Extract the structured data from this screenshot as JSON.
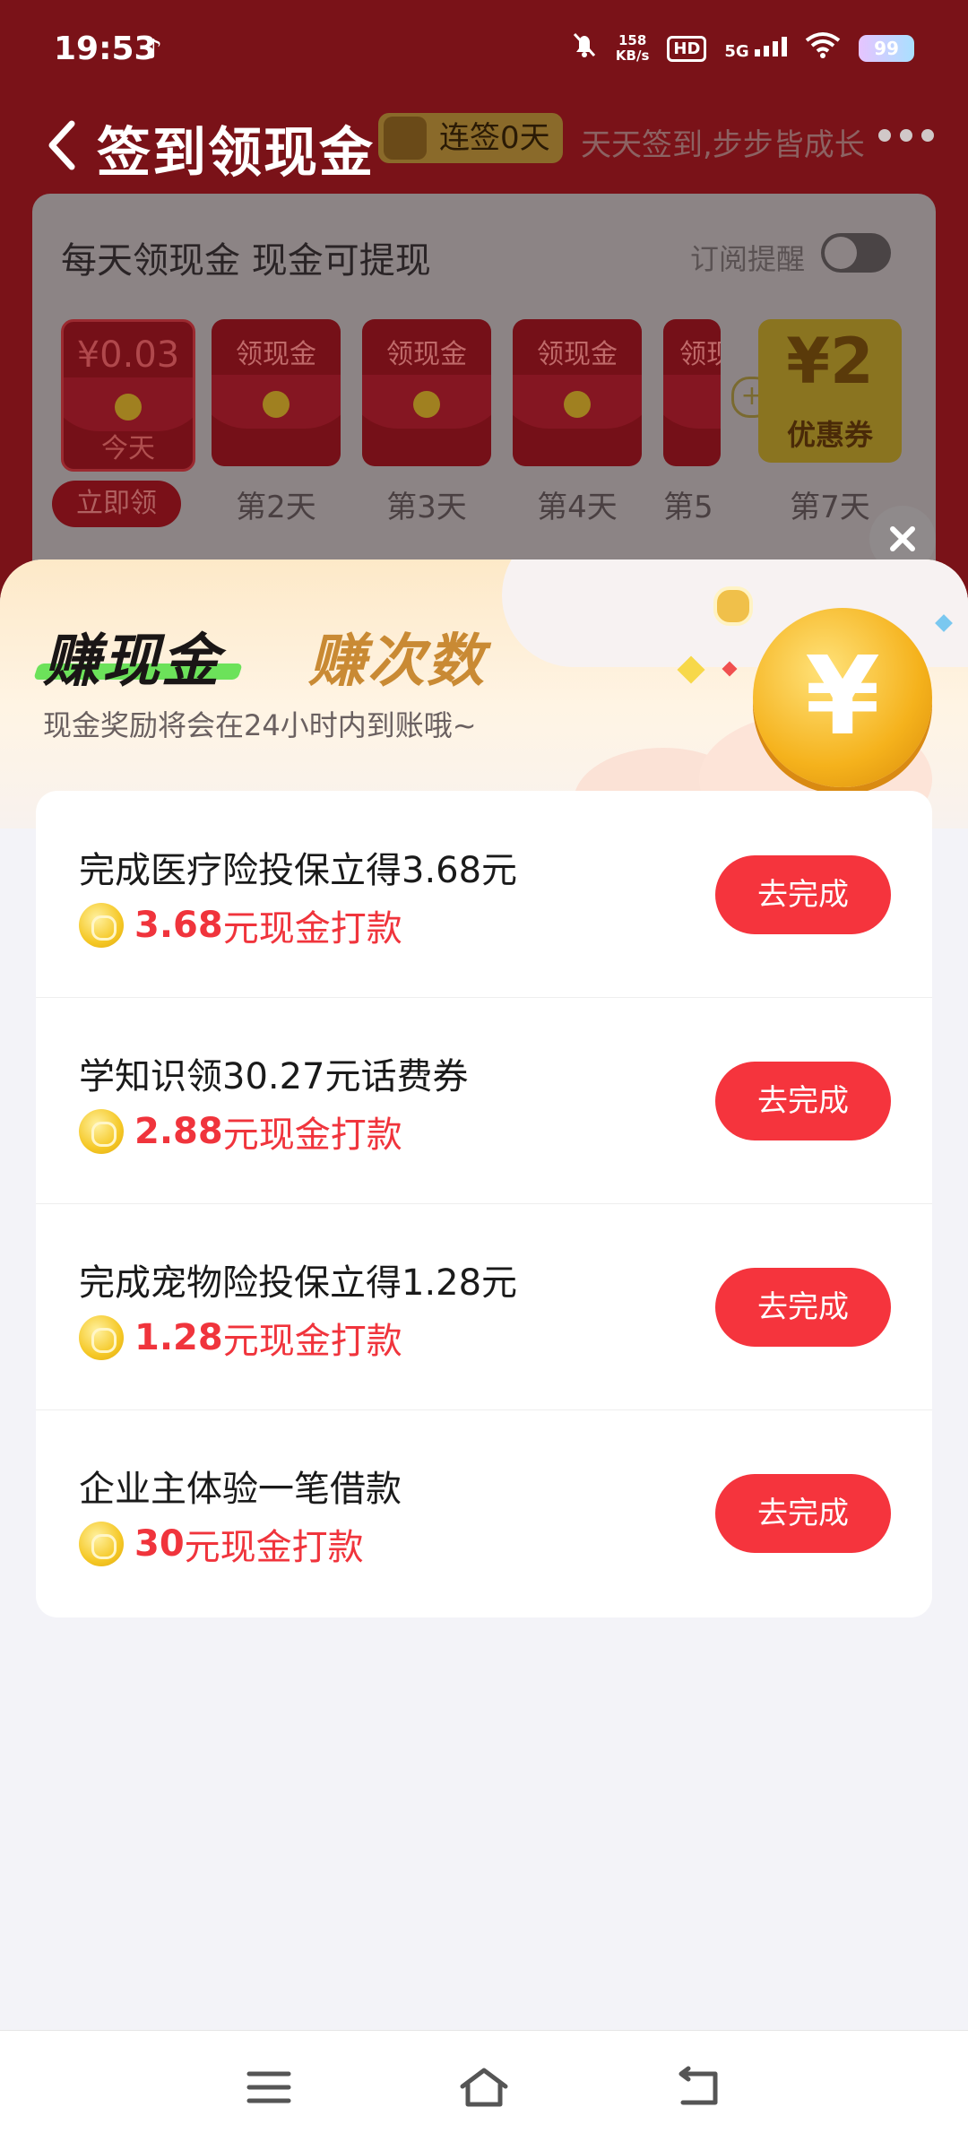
{
  "status_bar": {
    "time": "19:53",
    "note_icon": "♪",
    "speed_value": "158",
    "speed_unit": "KB/s",
    "hd": "HD",
    "network": "5G",
    "battery": "99"
  },
  "nav": {
    "title": "签到领现金",
    "streak": "连签0天",
    "slogan": "天天签到,步步皆成长"
  },
  "checkin": {
    "title": "每天领现金 现金可提现",
    "subscribe_label": "订阅提醒",
    "tiles": [
      {
        "amount": "¥0.03",
        "sub": "今天"
      },
      {
        "amount": "领现金"
      },
      {
        "amount": "领现金"
      },
      {
        "amount": "领现金"
      },
      {
        "amount": "领现"
      }
    ],
    "claim_button": "立即领",
    "day_labels": [
      "第2天",
      "第3天",
      "第4天",
      "第5"
    ],
    "coupon_value": "¥2",
    "coupon_label": "优惠券",
    "coupon_day": "第7天"
  },
  "sheet": {
    "tab_active": "赚现金",
    "tab_inactive": "赚次数",
    "subtitle": "现金奖励将会在24小时内到账哦~",
    "tasks": [
      {
        "title": "完成医疗险投保立得3.68元",
        "reward_amount": "3.68",
        "reward_text": "元现金打款",
        "button": "去完成"
      },
      {
        "title": "学知识领30.27元话费券",
        "reward_amount": "2.88",
        "reward_text": "元现金打款",
        "button": "去完成"
      },
      {
        "title": "完成宠物险投保立得1.28元",
        "reward_amount": "1.28",
        "reward_text": "元现金打款",
        "button": "去完成"
      },
      {
        "title": "企业主体验一笔借款",
        "reward_amount": "30",
        "reward_text": "元现金打款",
        "button": "去完成"
      }
    ]
  },
  "colors": {
    "accent_red": "#f5343d",
    "reward_red": "#f0343c",
    "tab_green": "#6ce25a",
    "tab_gold": "#c98a34"
  }
}
